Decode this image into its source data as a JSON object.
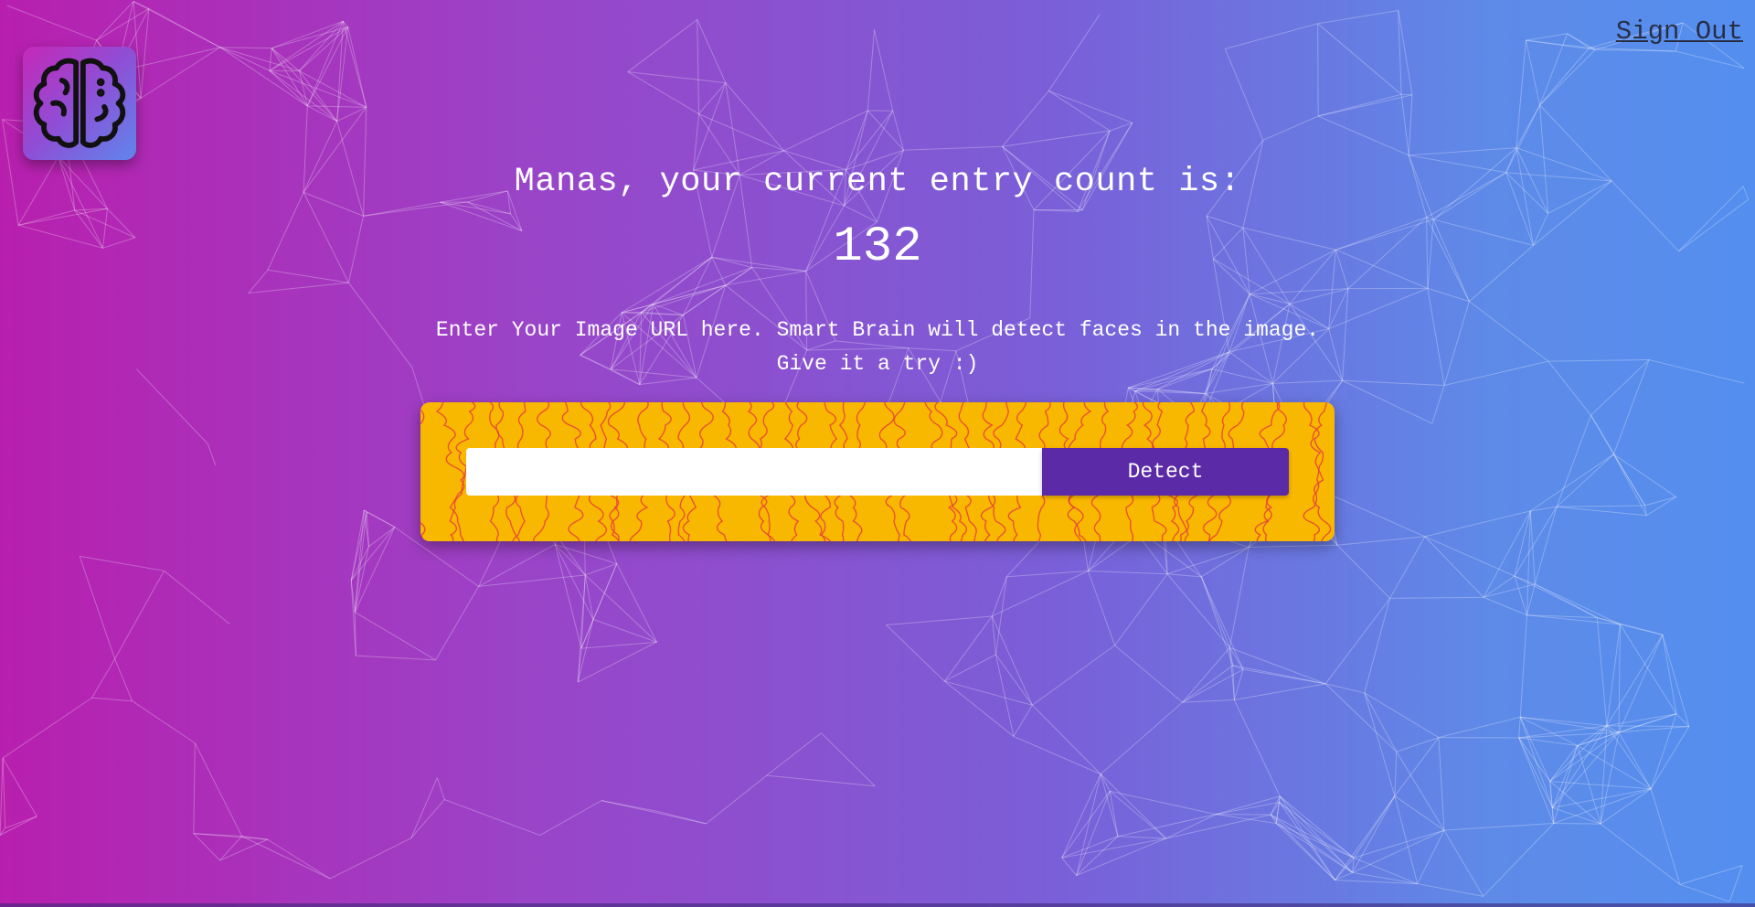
{
  "header": {
    "logo_icon": "brain-icon",
    "sign_out_label": "Sign Out"
  },
  "rank": {
    "greeting": "Manas, your current entry count is:",
    "count": "132"
  },
  "instructions": {
    "line1": "Enter Your Image URL here. Smart Brain will detect faces in the image.",
    "line2": "Give it a try :)"
  },
  "form": {
    "input_value": "",
    "input_placeholder": "",
    "detect_label": "Detect"
  },
  "colors": {
    "gradient_start": "#b81fae",
    "gradient_end": "#548fef",
    "panel": "#f9b800",
    "topo_lines": "#e8403a",
    "button": "#5b2aa6"
  }
}
